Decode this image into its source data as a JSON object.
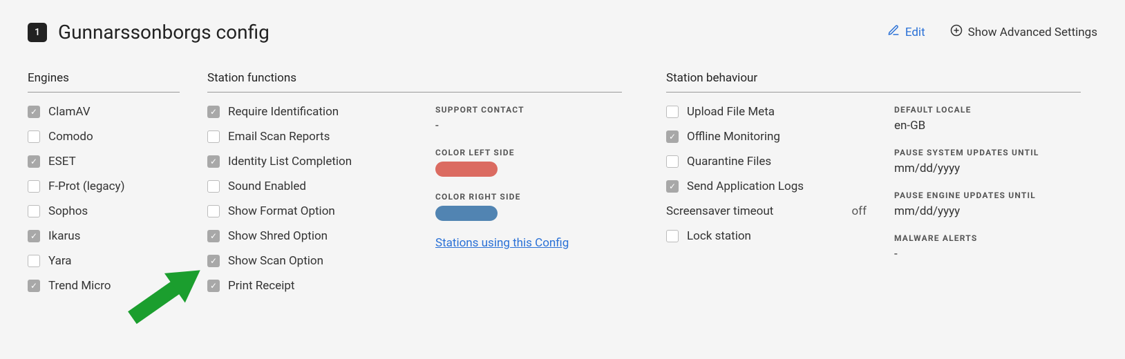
{
  "header": {
    "badge": "1",
    "title": "Gunnarssonborgs config",
    "edit_label": "Edit",
    "advanced_label": "Show Advanced Settings"
  },
  "engines": {
    "title": "Engines",
    "items": [
      {
        "label": "ClamAV",
        "checked": true
      },
      {
        "label": "Comodo",
        "checked": false
      },
      {
        "label": "ESET",
        "checked": true
      },
      {
        "label": "F-Prot (legacy)",
        "checked": false
      },
      {
        "label": "Sophos",
        "checked": false
      },
      {
        "label": "Ikarus",
        "checked": true
      },
      {
        "label": "Yara",
        "checked": false
      },
      {
        "label": "Trend Micro",
        "checked": true
      }
    ]
  },
  "station_functions": {
    "title": "Station functions",
    "items": [
      {
        "label": "Require Identification",
        "checked": true
      },
      {
        "label": "Email Scan Reports",
        "checked": false
      },
      {
        "label": "Identity List Completion",
        "checked": true
      },
      {
        "label": "Sound Enabled",
        "checked": false
      },
      {
        "label": "Show Format Option",
        "checked": false
      },
      {
        "label": "Show Shred Option",
        "checked": true
      },
      {
        "label": "Show Scan Option",
        "checked": true
      },
      {
        "label": "Print Receipt",
        "checked": true
      }
    ],
    "support_contact_label": "SUPPORT CONTACT",
    "support_contact_value": "-",
    "color_left_label": "COLOR LEFT SIDE",
    "color_left_value": "#db6b61",
    "color_right_label": "COLOR RIGHT SIDE",
    "color_right_value": "#5184b2",
    "stations_link": "Stations using this Config"
  },
  "station_behaviour": {
    "title": "Station behaviour",
    "items": [
      {
        "label": "Upload File Meta",
        "checked": false
      },
      {
        "label": "Offline Monitoring",
        "checked": true
      },
      {
        "label": "Quarantine Files",
        "checked": false
      },
      {
        "label": "Send Application Logs",
        "checked": true
      }
    ],
    "screensaver_label": "Screensaver timeout",
    "screensaver_value": "off",
    "lock_station": {
      "label": "Lock station",
      "checked": false
    },
    "default_locale_label": "DEFAULT LOCALE",
    "default_locale_value": "en-GB",
    "pause_system_label": "PAUSE SYSTEM UPDATES UNTIL",
    "pause_system_value": "mm/dd/yyyy",
    "pause_engine_label": "PAUSE ENGINE UPDATES UNTIL",
    "pause_engine_value": "mm/dd/yyyy",
    "malware_alerts_label": "MALWARE ALERTS",
    "malware_alerts_value": "-"
  }
}
